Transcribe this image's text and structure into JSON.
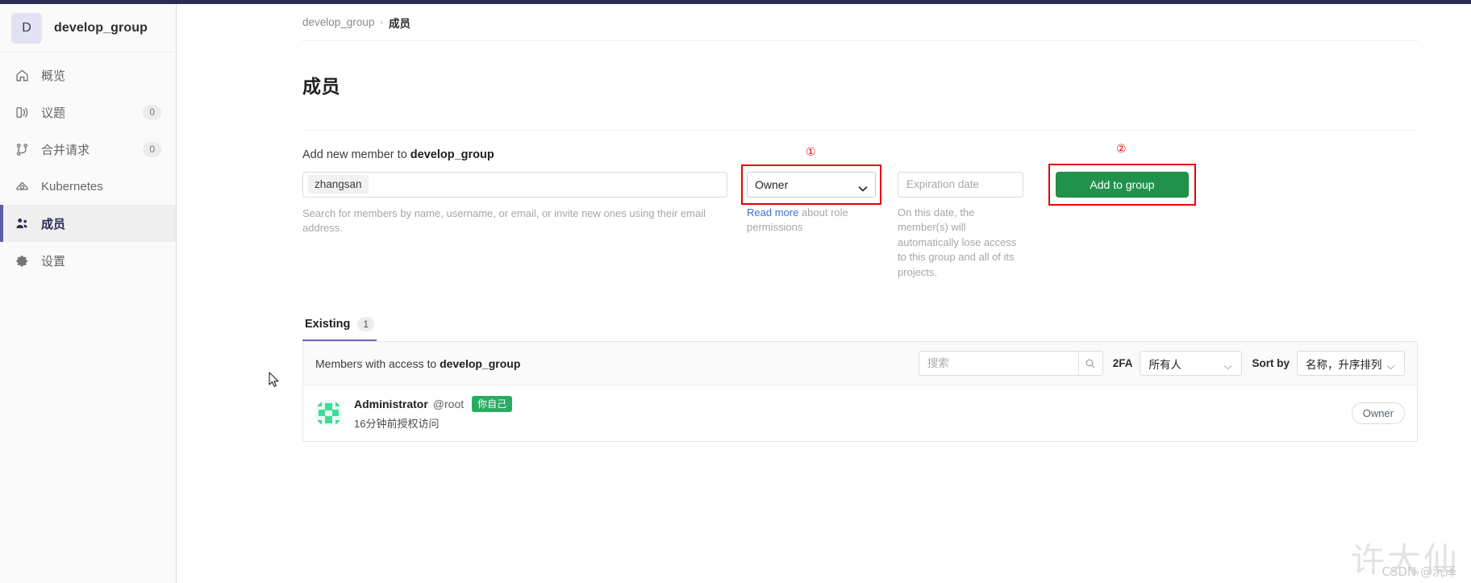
{
  "sidebar": {
    "group_initial": "D",
    "group_name": "develop_group",
    "items": [
      {
        "label": "概览",
        "icon": "home-icon",
        "count": "",
        "active": false
      },
      {
        "label": "议题",
        "icon": "issues-icon",
        "count": "0",
        "active": false
      },
      {
        "label": "合并请求",
        "icon": "merge-request-icon",
        "count": "0",
        "active": false
      },
      {
        "label": "Kubernetes",
        "icon": "kubernetes-icon",
        "count": "",
        "active": false
      },
      {
        "label": "成员",
        "icon": "members-icon",
        "count": "",
        "active": true
      },
      {
        "label": "设置",
        "icon": "gear-icon",
        "count": "",
        "active": false
      }
    ]
  },
  "breadcrumb": {
    "root": "develop_group",
    "separator": "›",
    "current": "成员"
  },
  "page_title": "成员",
  "add_member": {
    "label_prefix": "Add new member to ",
    "label_group": "develop_group",
    "search_token": "zhangsan",
    "search_hint": "Search for members by name, username, or email, or invite new ones using their email address.",
    "role_value": "Owner",
    "role_note_link": "Read more",
    "role_note_rest": " about role permissions",
    "expiration_placeholder": "Expiration date",
    "expiration_value": "",
    "expiration_note": "On this date, the member(s) will automatically lose access to this group and all of its projects.",
    "add_button_label": "Add to group",
    "marker_role": "①",
    "marker_button": "②"
  },
  "tabs": [
    {
      "label": "Existing",
      "count": "1",
      "active": true
    }
  ],
  "members_panel": {
    "title_prefix": "Members with access to ",
    "title_group": "develop_group",
    "search_placeholder": "搜索",
    "search_value": "",
    "twofa_label": "2FA",
    "twofa_value": "所有人",
    "sort_label": "Sort by",
    "sort_value": "名称，升序排列",
    "rows": [
      {
        "name": "Administrator",
        "handle": "@root",
        "badge": "你自己",
        "meta": "16分钟前授权访问",
        "role": "Owner"
      }
    ]
  },
  "watermark": {
    "big": "许大仙",
    "small": "CSDN @沉泽"
  },
  "colors": {
    "accent_purple": "#2d2a56",
    "active_bar": "#5c5ca8",
    "green_button": "#21924b",
    "annotation_red": "#e60000",
    "link_blue": "#3f6fd1"
  }
}
